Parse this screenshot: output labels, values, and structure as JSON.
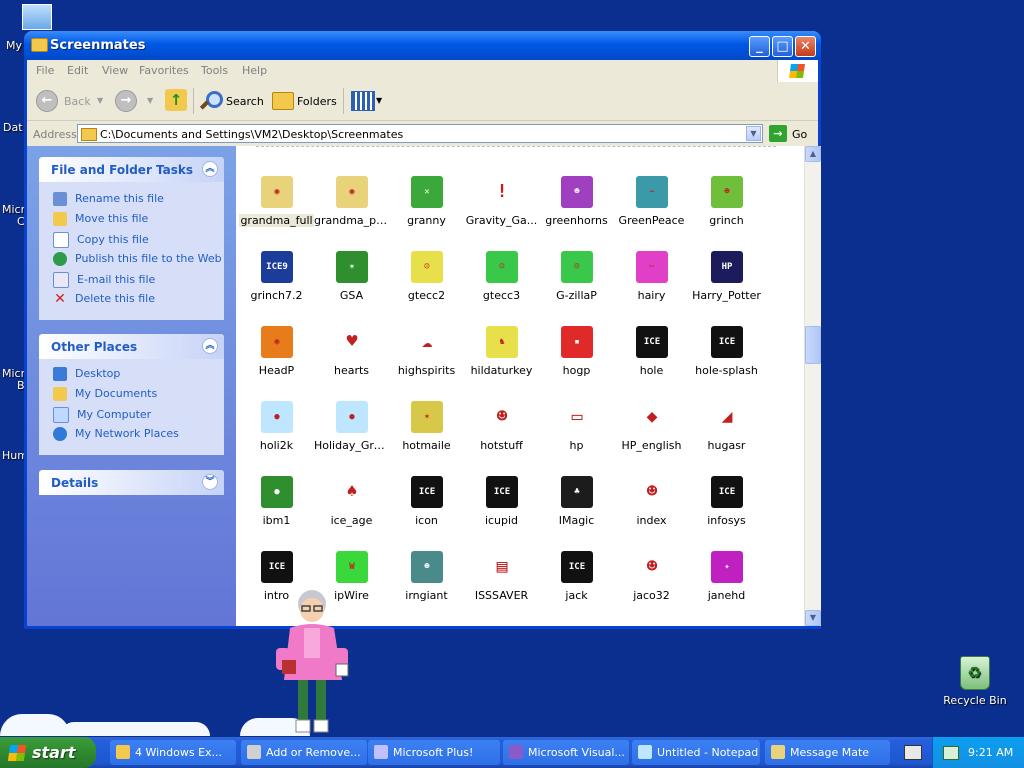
{
  "desktop": {
    "icon_labels_partial": [
      "My",
      "Dat",
      "Micr",
      "C",
      "Micr",
      "B",
      "Hum"
    ],
    "recycle_bin": "Recycle Bin"
  },
  "window": {
    "title": "Screenmates",
    "controls": {
      "minimize": "_",
      "maximize": "□",
      "close": "✕"
    },
    "menu": [
      "File",
      "Edit",
      "View",
      "Favorites",
      "Tools",
      "Help"
    ],
    "toolbar": {
      "back": "Back",
      "search": "Search",
      "folders": "Folders"
    },
    "address": {
      "label": "Address",
      "path": "C:\\Documents and Settings\\VM2\\Desktop\\Screenmates",
      "go": "Go"
    },
    "tasks_panel": {
      "title": "File and Folder Tasks",
      "items": [
        "Rename this file",
        "Move this file",
        "Copy this file",
        "Publish this file to the Web",
        "E-mail this file",
        "Delete this file"
      ]
    },
    "places_panel": {
      "title": "Other Places",
      "items": [
        "Desktop",
        "My Documents",
        "My Computer",
        "My Network Places"
      ]
    },
    "details_panel": {
      "title": "Details"
    },
    "files": [
      [
        {
          "label": "grandma_full",
          "icon": "grandma-icon",
          "color": "#e8d27a",
          "glyph": "◉",
          "selected": true
        },
        {
          "label": "grandma_paid",
          "icon": "grandma-icon",
          "color": "#e8d27a",
          "glyph": "◉"
        },
        {
          "label": "granny",
          "icon": "yarn-ball-icon",
          "color": "#3aa83a",
          "glyph": "✕"
        },
        {
          "label": "Gravity_Ga...",
          "icon": "gravity-icon",
          "color": "#ffffff",
          "glyph": "!"
        },
        {
          "label": "greenhorns",
          "icon": "greenhorn-icon",
          "color": "#a040c0",
          "glyph": "☻"
        },
        {
          "label": "GreenPeace",
          "icon": "whale-icon",
          "color": "#3a9aa8",
          "glyph": "~"
        },
        {
          "label": "grinch",
          "icon": "grinch-icon",
          "color": "#6fbf3a",
          "glyph": "☻"
        }
      ],
      [
        {
          "label": "grinch7.2",
          "icon": "ice9-icon",
          "color": "#1c3c9c",
          "glyph": "ICE9"
        },
        {
          "label": "GSA",
          "icon": "dragon-icon",
          "color": "#2f8f2f",
          "glyph": "✶"
        },
        {
          "label": "gtecc2",
          "icon": "face-icon",
          "color": "#e8e04a",
          "glyph": "☺"
        },
        {
          "label": "gtecc3",
          "icon": "face-icon",
          "color": "#3ac84a",
          "glyph": "☺"
        },
        {
          "label": "G-zillaP",
          "icon": "face-icon",
          "color": "#3ac84a",
          "glyph": "☺"
        },
        {
          "label": "hairy",
          "icon": "scissors-icon",
          "color": "#e040c8",
          "glyph": "✂"
        },
        {
          "label": "Harry_Potter",
          "icon": "hp-logo-icon",
          "color": "#1c1c5c",
          "glyph": "HP"
        }
      ],
      [
        {
          "label": "HeadP",
          "icon": "pumpkin-icon",
          "color": "#e87c1a",
          "glyph": "◉"
        },
        {
          "label": "hearts",
          "icon": "heart-icon",
          "color": "#ffffff",
          "glyph": "♥"
        },
        {
          "label": "highspirits",
          "icon": "ghost-icon",
          "color": "#ffffff",
          "glyph": "☁"
        },
        {
          "label": "hildaturkey",
          "icon": "turkey-icon",
          "color": "#e8e04a",
          "glyph": "♞"
        },
        {
          "label": "hogp",
          "icon": "robot-icon",
          "color": "#e02a2a",
          "glyph": "▪"
        },
        {
          "label": "hole",
          "icon": "ice-ix-icon",
          "color": "#111111",
          "glyph": "ICE"
        },
        {
          "label": "hole-splash",
          "icon": "ice-ix-icon",
          "color": "#111111",
          "glyph": "ICE"
        }
      ],
      [
        {
          "label": "holi2k",
          "icon": "snowball-icon",
          "color": "#bfe6ff",
          "glyph": "●"
        },
        {
          "label": "Holiday_Gre...",
          "icon": "snowball-icon",
          "color": "#bfe6ff",
          "glyph": "●"
        },
        {
          "label": "hotmaile",
          "icon": "dragon-icon",
          "color": "#d8c84a",
          "glyph": "✶"
        },
        {
          "label": "hotstuff",
          "icon": "devil-icon",
          "color": "#ffffff",
          "glyph": "☻"
        },
        {
          "label": "hp",
          "icon": "window-icon",
          "color": "#ffffff",
          "glyph": "▭"
        },
        {
          "label": "HP_english",
          "icon": "fish-icon",
          "color": "#ffffff",
          "glyph": "◆"
        },
        {
          "label": "hugasr",
          "icon": "rock-icon",
          "color": "#ffffff",
          "glyph": "◢"
        }
      ],
      [
        {
          "label": "ibm1",
          "icon": "tennis-ball-icon",
          "color": "#2f8f2f",
          "glyph": "●"
        },
        {
          "label": "ice_age",
          "icon": "acorn-icon",
          "color": "#ffffff",
          "glyph": "♠"
        },
        {
          "label": "icon",
          "icon": "ice-ix-icon",
          "color": "#111111",
          "glyph": "ICE"
        },
        {
          "label": "icupid",
          "icon": "ice-ix-icon",
          "color": "#111111",
          "glyph": "ICE"
        },
        {
          "label": "IMagic",
          "icon": "christmas-tree-icon",
          "color": "#1c1c1c",
          "glyph": "♣"
        },
        {
          "label": "index",
          "icon": "raccoon-icon",
          "color": "#ffffff",
          "glyph": "☻"
        },
        {
          "label": "infosys",
          "icon": "ice-ix-icon",
          "color": "#111111",
          "glyph": "ICE"
        }
      ],
      [
        {
          "label": "intro",
          "icon": "ice-ix-icon",
          "color": "#111111",
          "glyph": "ICE"
        },
        {
          "label": "ipWire",
          "icon": "w-logo-icon",
          "color": "#3ad83a",
          "glyph": "W"
        },
        {
          "label": "irngiant",
          "icon": "iron-giant-icon",
          "color": "#4a8a8a",
          "glyph": "☻"
        },
        {
          "label": "ISSSAVER",
          "icon": "computer-icon",
          "color": "#ffffff",
          "glyph": "▤"
        },
        {
          "label": "jack",
          "icon": "ice-ix-icon",
          "color": "#111111",
          "glyph": "ICE"
        },
        {
          "label": "jaco32",
          "icon": "red-face-icon",
          "color": "#ffffff",
          "glyph": "☻"
        },
        {
          "label": "janehd",
          "icon": "janehd-icon",
          "color": "#c020c0",
          "glyph": "✦"
        }
      ]
    ]
  },
  "taskbar": {
    "start": "start",
    "buttons": [
      {
        "label": "4 Windows Ex...",
        "icon": "folder-icon",
        "color": "#f2c94c"
      },
      {
        "label": "Add or Remove...",
        "icon": "add-remove-icon",
        "color": "#d0d0d0"
      },
      {
        "label": "Microsoft Plus!",
        "icon": "plus-icon",
        "color": "#c0c0ff"
      },
      {
        "label": "Microsoft Visual...",
        "icon": "visual-studio-icon",
        "color": "#8a5ac8"
      },
      {
        "label": "Untitled - Notepad",
        "icon": "notepad-icon",
        "color": "#bfe6ff"
      },
      {
        "label": "Message Mate",
        "icon": "message-mate-icon",
        "color": "#e8d27a"
      }
    ],
    "clock": "9:21 AM"
  }
}
